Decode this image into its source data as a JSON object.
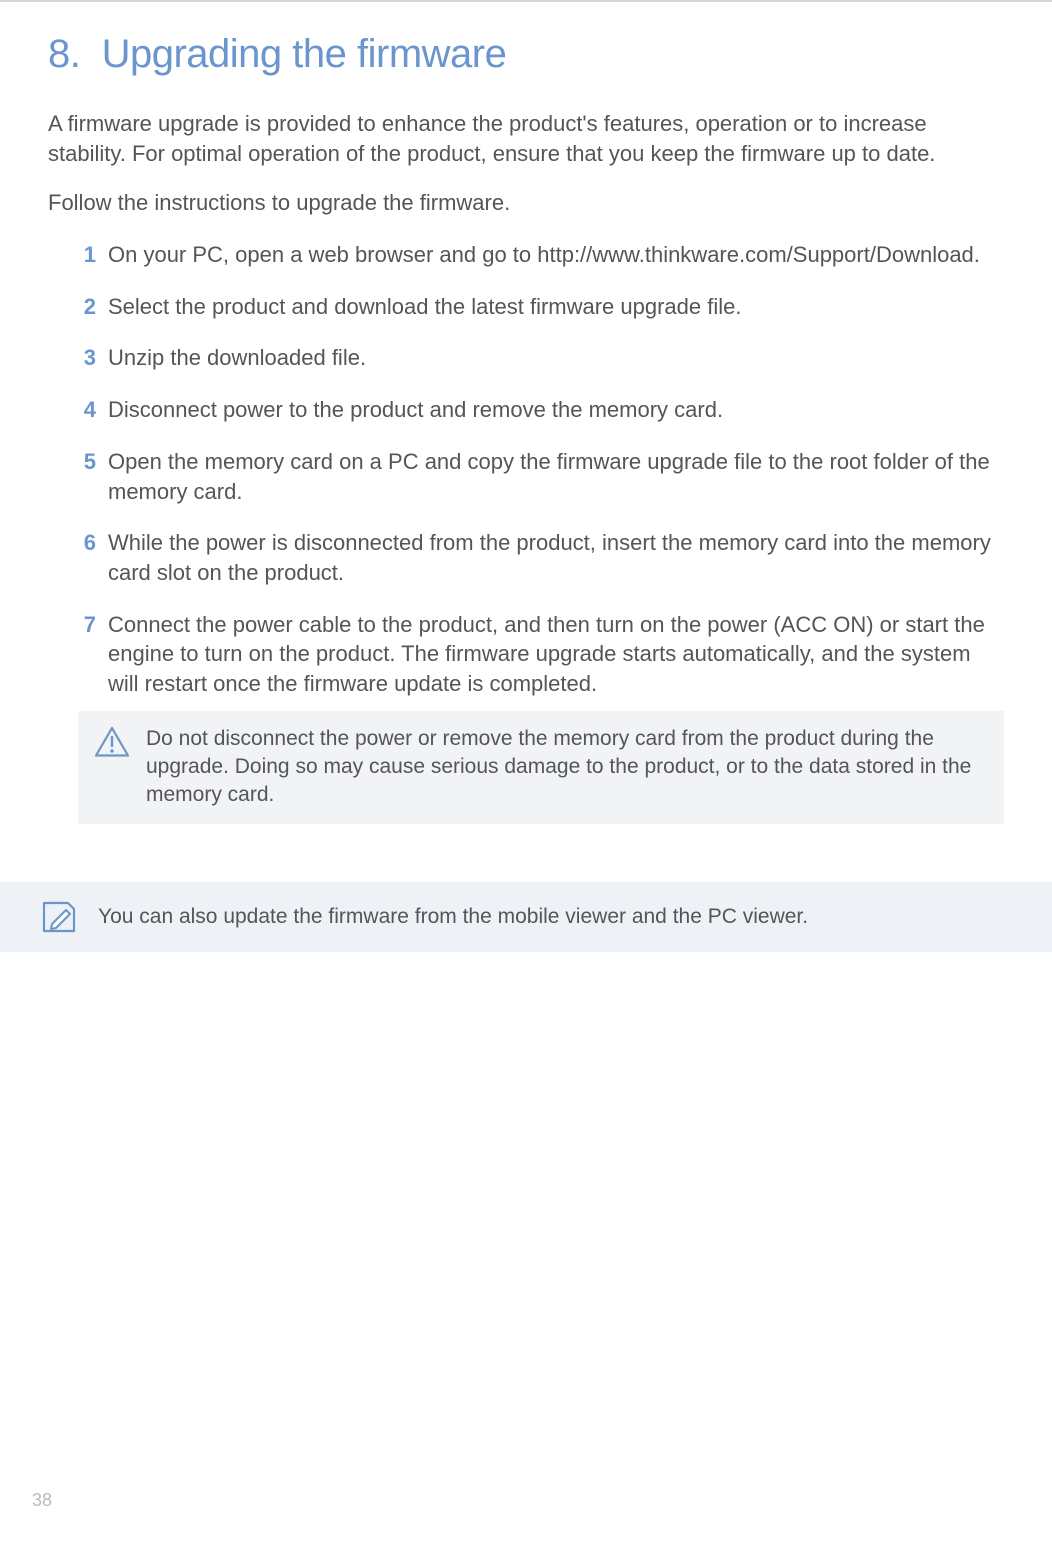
{
  "heading": {
    "number": "8.",
    "title": "Upgrading the firmware"
  },
  "intro": "A firmware upgrade is provided to enhance the product's features, operation or to increase stability. For optimal operation of the product, ensure that you keep the firmware up to date.",
  "follow": "Follow the instructions to upgrade the firmware.",
  "steps": [
    {
      "n": "1",
      "text": "On your PC, open a web browser and go to http://www.thinkware.com/Support/Download."
    },
    {
      "n": "2",
      "text": "Select the product and download the latest firmware upgrade file."
    },
    {
      "n": "3",
      "text": "Unzip the downloaded file."
    },
    {
      "n": "4",
      "text": "Disconnect power to the product and remove the memory card."
    },
    {
      "n": "5",
      "text": "Open the memory card on a PC and copy the firmware upgrade file to the root folder of the memory card."
    },
    {
      "n": "6",
      "text": "While the power is disconnected from the product, insert the memory card into the memory card slot on the product."
    },
    {
      "n": "7",
      "text": "Connect the power cable to the product, and then turn on the power (ACC ON) or start the engine to turn on the product. The firmware upgrade starts automatically, and the system will restart once the firmware update is completed."
    }
  ],
  "warning": "Do not disconnect the power or remove the memory card from the product during the upgrade. Doing so may cause serious damage to the product, or to the data stored in the memory card.",
  "note": "You can also update the firmware from the mobile viewer and the PC viewer.",
  "page_number": "38",
  "colors": {
    "accent": "#6a95cd"
  }
}
